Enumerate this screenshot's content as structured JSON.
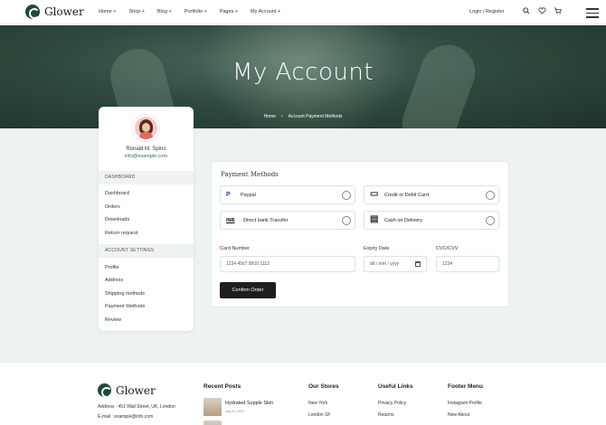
{
  "header": {
    "brand": "Glower",
    "nav": [
      "Home +",
      "Shop +",
      "Blog +",
      "Portfolio +",
      "Pages +",
      "My Account +"
    ],
    "login": "Login / Register",
    "icons": [
      "search-icon",
      "heart-icon",
      "cart-icon",
      "menu-icon"
    ]
  },
  "hero": {
    "title": "My Account",
    "breadcrumb_home": "Home",
    "breadcrumb_sep": "•",
    "breadcrumb_current": "Account Payment Methods"
  },
  "sidebar": {
    "name": "Ronald M. Spino",
    "email": "info@example.com",
    "dashboard_heading": "DASHBOARD",
    "dashboard_items": [
      "Dashboard",
      "Orders",
      "Downloads",
      "Return request"
    ],
    "settings_heading": "ACCOUNT SETTINGS",
    "settings_items": [
      "Profile",
      "Address",
      "Shipping methods",
      "Payment Methods",
      "Review"
    ]
  },
  "payment": {
    "title": "Payment Methods",
    "options": [
      {
        "label": "Paypal",
        "icon": "P"
      },
      {
        "label": "Credit or Debit Card",
        "icon": "▭"
      },
      {
        "label": "Direct bank Transfer",
        "icon": "INB"
      },
      {
        "label": "Cash on Delivery",
        "icon": "▤"
      }
    ],
    "card_label": "Card Number",
    "card_value": "1234 4567 8910 1112",
    "expiry_label": "Expiry Date",
    "expiry_placeholder": "dd / mm / yyyy",
    "cvc_label": "CVC/CVV",
    "cvc_value": "1234",
    "confirm_label": "Confirm Order"
  },
  "footer": {
    "brand": "Glower",
    "address": "Address : 451 Wall Street, UK, London",
    "email": "E-mail : example@info.com",
    "recent_posts_heading": "Recent Posts",
    "post_title": "Hydrated Supple Skin",
    "post_date": "July 21, 2023",
    "stores_heading": "Our Stores",
    "stores": [
      "New York",
      "London SF"
    ],
    "links_heading": "Useful Links",
    "links": [
      "Privacy Policy",
      "Returns"
    ],
    "menu_heading": "Footer Menu",
    "menu": [
      "Instagram Profile",
      "New About"
    ]
  }
}
